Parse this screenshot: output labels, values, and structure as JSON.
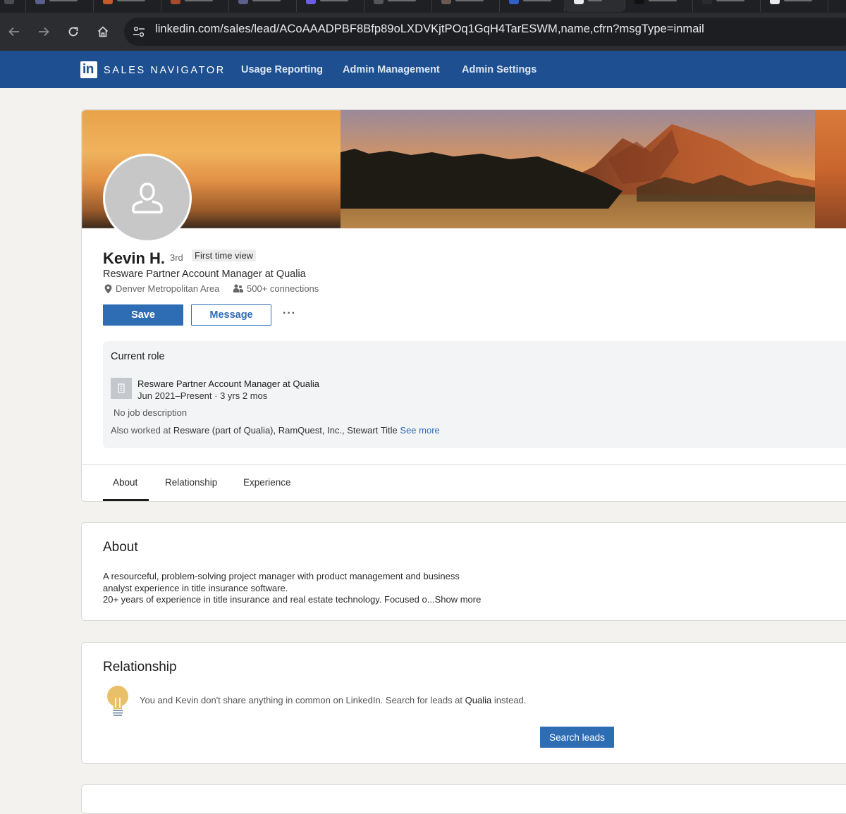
{
  "browser": {
    "url": "linkedin.com/sales/lead/ACoAAADPBF8Bfp89oLXDVKjtPOq1GqH4TarESWM,name,cfrn?msgType=inmail"
  },
  "appnav": {
    "brand": "SALES NAVIGATOR",
    "links": [
      "Usage Reporting",
      "Admin Management",
      "Admin Settings"
    ]
  },
  "profile": {
    "name": "Kevin H.",
    "degree": "3rd",
    "badge": "First time view",
    "headline": "Resware Partner Account Manager at Qualia",
    "location": "Denver Metropolitan Area",
    "connections": "500+ connections",
    "save_label": "Save",
    "message_label": "Message",
    "more_label": "···"
  },
  "current_role": {
    "heading": "Current role",
    "title": "Resware Partner Account Manager at Qualia",
    "dates": "Jun 2021–Present · 3 yrs 2 mos",
    "description": "No job description",
    "also_prefix": "Also worked at",
    "also_companies": "Resware (part of Qualia), RamQuest, Inc., Stewart Title",
    "see_more": "See more"
  },
  "tabs": [
    "About",
    "Relationship",
    "Experience"
  ],
  "about": {
    "heading": "About",
    "line1": "A resourceful, problem-solving project manager with product management and business",
    "line2": "analyst experience in title insurance software.",
    "line3": "20+ years of experience in title insurance and real estate technology. Focused o...",
    "show_more": "Show more"
  },
  "relationship": {
    "heading": "Relationship",
    "text_prefix": "You and Kevin don't share anything in common on LinkedIn. Search for leads at",
    "company": "Qualia",
    "text_suffix": "instead.",
    "button": "Search leads"
  },
  "colors": {
    "nav_bg": "#1d4f91",
    "primary": "#2e6db4",
    "page_bg": "#f3f2ef"
  }
}
